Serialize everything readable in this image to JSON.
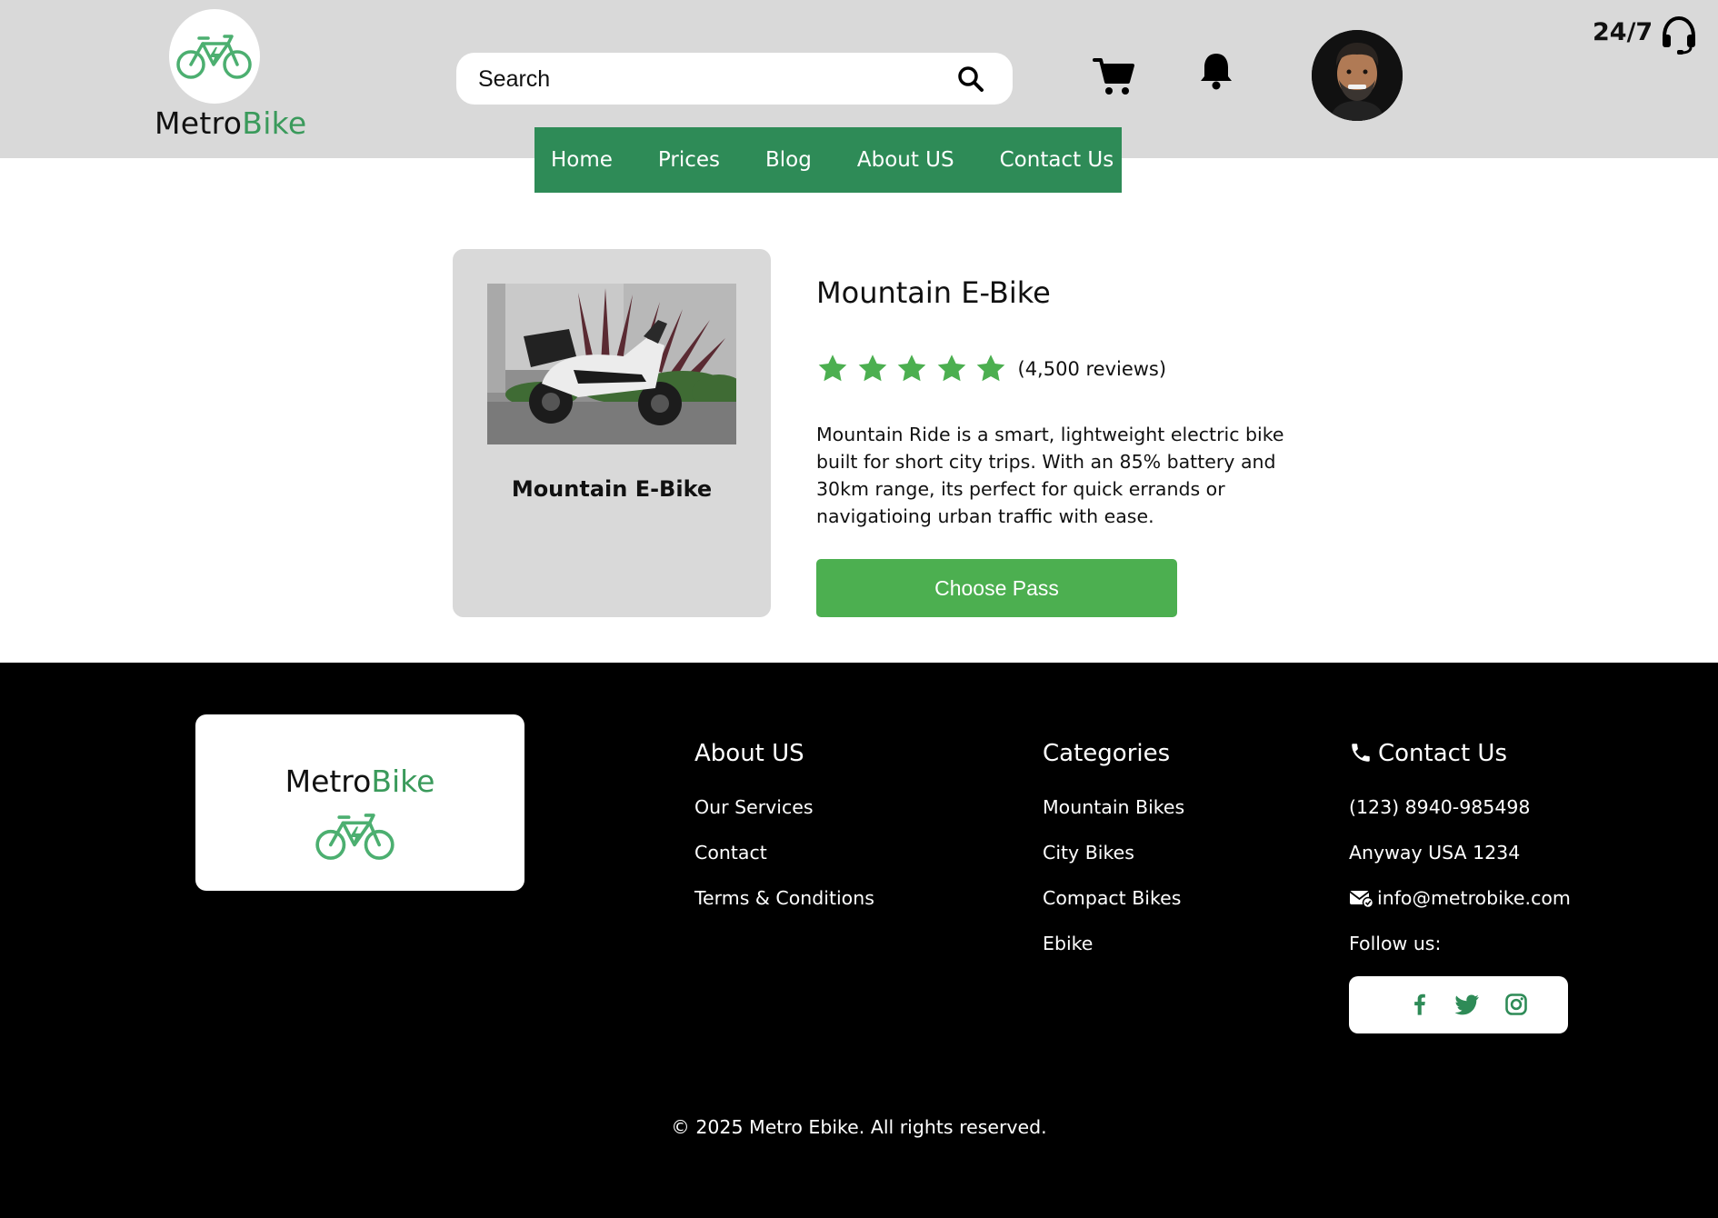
{
  "header": {
    "logo": {
      "metro": "Metro",
      "bike": "Bike"
    },
    "search": {
      "placeholder": "Search"
    },
    "support": {
      "text": "24/7"
    }
  },
  "nav": {
    "items": [
      {
        "label": "Home"
      },
      {
        "label": "Prices"
      },
      {
        "label": "Blog"
      },
      {
        "label": "About US"
      },
      {
        "label": "Contact Us"
      }
    ]
  },
  "product": {
    "card_title": "Mountain E-Bike",
    "title": "Mountain E-Bike",
    "rating_stars": 5,
    "reviews": "(4,500 reviews)",
    "description": "Mountain Ride is a smart, lightweight electric bike built for short city trips. With an 85% battery and 30km range, its perfect for quick errands or navigatioing urban traffic with ease.",
    "cta_label": "Choose Pass"
  },
  "footer": {
    "logo": {
      "metro": "Metro",
      "bike": "Bike"
    },
    "about": {
      "heading": "About US",
      "links": [
        "Our Services",
        "Contact",
        "Terms & Conditions"
      ]
    },
    "categories": {
      "heading": "Categories",
      "links": [
        "Mountain Bikes",
        "City Bikes",
        "Compact Bikes",
        "Ebike"
      ]
    },
    "contact": {
      "heading": "Contact Us",
      "phone": "(123) 8940-985498",
      "address": "Anyway USA 1234",
      "email": "info@metrobike.com",
      "follow": "Follow us:"
    },
    "copyright": "© 2025 Metro Ebike. All rights reserved."
  },
  "colors": {
    "brand_green": "#2e8b57",
    "accent_green": "#4caf50",
    "header_bg": "#d9d9d9",
    "footer_bg": "#000000"
  },
  "icons": [
    "bike-icon",
    "search-icon",
    "cart-icon",
    "bell-icon",
    "headset-icon",
    "star-icon",
    "phone-icon",
    "mail-icon",
    "facebook-icon",
    "twitter-icon",
    "instagram-icon"
  ]
}
